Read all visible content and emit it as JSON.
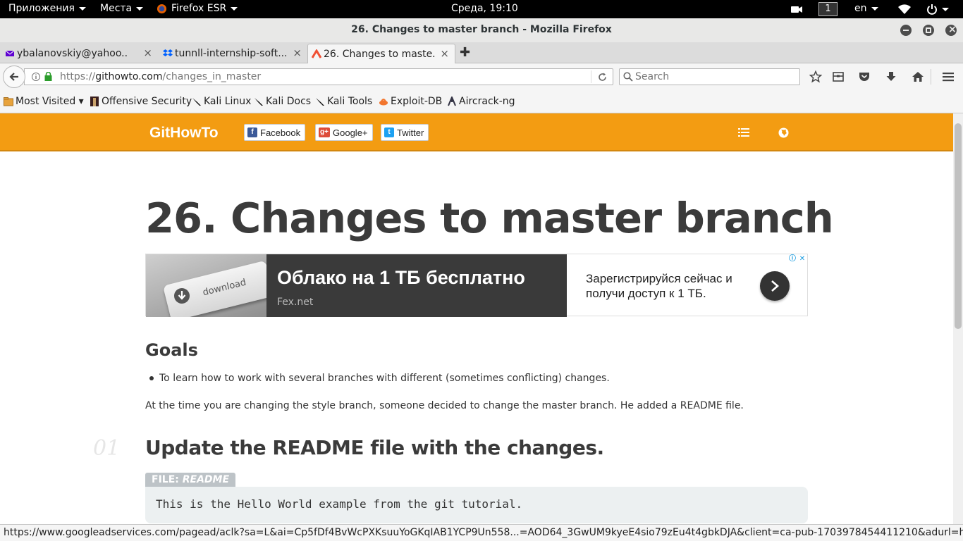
{
  "topbar": {
    "apps_label": "Приложения",
    "places_label": "Места",
    "browser_label": "Firefox ESR",
    "clock": "Среда, 19:10",
    "workspace": "1",
    "lang": "en"
  },
  "window": {
    "title": "26. Changes to master branch - Mozilla Firefox"
  },
  "tabs": [
    {
      "label": "ybalanovskiy@yahoo...."
    },
    {
      "label": "tunnll-internship-soft..."
    },
    {
      "label": "26. Changes to maste..."
    }
  ],
  "nav": {
    "url_prefix": "https://",
    "url_domain": "githowto.com",
    "url_path": "/changes_in_master",
    "search_placeholder": "Search"
  },
  "bookmarks": [
    {
      "label": "Most Visited ▾"
    },
    {
      "label": "Offensive Security"
    },
    {
      "label": "Kali Linux"
    },
    {
      "label": "Kali Docs"
    },
    {
      "label": "Kali Tools"
    },
    {
      "label": "Exploit-DB"
    },
    {
      "label": "Aircrack-ng"
    }
  ],
  "site": {
    "brand": "GitHowTo",
    "share": {
      "facebook": "Facebook",
      "google": "Google+",
      "twitter": "Twitter"
    },
    "accent": "#f39c12"
  },
  "article": {
    "title": "26. Changes to master branch",
    "goals_heading": "Goals",
    "goal_item": "To learn how to work with several branches with different (sometimes conflicting) changes.",
    "intro": "At the time you are changing the style branch, someone decided to change the master branch. He added a README file.",
    "step_number": "01",
    "step_title": "Update the README file with the changes.",
    "file_label_prefix": "FILE: ",
    "file_name": "README",
    "code": "This is the Hello World example from the git tutorial."
  },
  "ad": {
    "image_text": "download",
    "headline": "Облако на 1 ТБ бесплатно",
    "domain": "Fex.net",
    "text": "Зарегистрируйся сейчас и получи доступ к 1 ТБ."
  },
  "status": {
    "url": "https://www.googleadservices.com/pagead/aclk?sa=L&ai=Cp5fDf4BvWcPXKsuuYoGKqIAB1YCP9Un558...=AOD64_3GwUM9kyeE4sio79zEu4t4gbkDJA&client=ca-pub-1703978454411210&adurl=http://fex.net"
  }
}
